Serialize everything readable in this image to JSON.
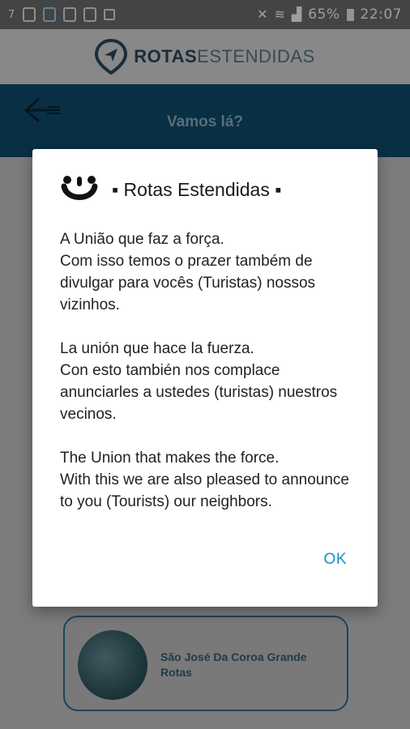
{
  "status_bar": {
    "battery": "65%",
    "time": "22:07",
    "notification_small_text": "7"
  },
  "header": {
    "brand_bold": "ROTAS",
    "brand_light": "ESTENDIDAS"
  },
  "toolbar": {
    "title": "Vamos lá?"
  },
  "background_card": {
    "label": "São José Da Coroa Grande Rotas"
  },
  "dialog": {
    "title": "▪ Rotas Estendidas ▪",
    "paragraphs": [
      "A União que faz a força.\nCom isso temos o prazer também de divulgar para vocês (Turistas) nossos vizinhos.",
      "La unión que hace la fuerza.\nCon esto también nos complace anunciarles a ustedes (turistas) nuestros vecinos.",
      "The Union that makes the force.\nWith this we are also pleased to announce to you (Tourists) our neighbors."
    ],
    "ok_label": "OK"
  },
  "colors": {
    "toolbar": "#0f4c6f",
    "accent": "#1a8ec6",
    "card_border": "#2c6f95"
  }
}
